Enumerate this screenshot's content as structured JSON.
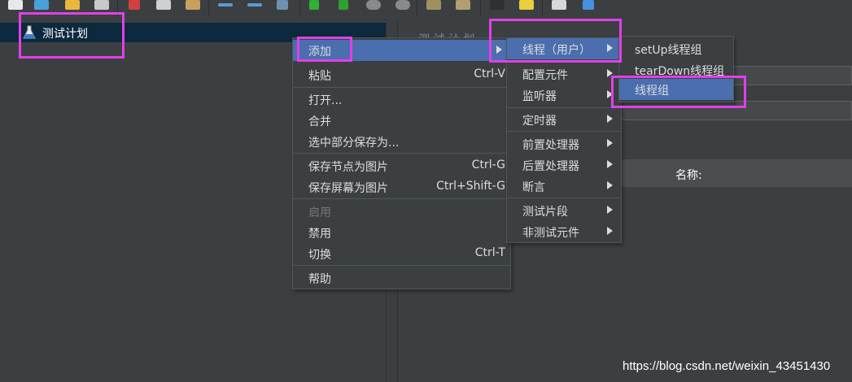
{
  "tree": {
    "root_label": "测试计划"
  },
  "right_panel": {
    "name_label": "名称:",
    "partial_title": "测 试 计 划"
  },
  "menu_main": {
    "items": [
      {
        "label": "添加",
        "shortcut": "",
        "submenu": true,
        "highlighted": true
      },
      {
        "label": "粘贴",
        "shortcut": "Ctrl-V"
      },
      {
        "label": "打开...",
        "shortcut": ""
      },
      {
        "label": "合并",
        "shortcut": ""
      },
      {
        "label": "选中部分保存为...",
        "shortcut": ""
      },
      {
        "label": "保存节点为图片",
        "shortcut": "Ctrl-G"
      },
      {
        "label": "保存屏幕为图片",
        "shortcut": "Ctrl+Shift-G"
      },
      {
        "label": "启用",
        "shortcut": "",
        "disabled": true
      },
      {
        "label": "禁用",
        "shortcut": ""
      },
      {
        "label": "切换",
        "shortcut": "Ctrl-T"
      },
      {
        "label": "帮助",
        "shortcut": ""
      }
    ]
  },
  "menu_add": {
    "items": [
      {
        "label": "线程（用户）",
        "submenu": true,
        "highlighted": true
      },
      {
        "label": "配置元件",
        "submenu": true
      },
      {
        "label": "监听器",
        "submenu": true
      },
      {
        "label": "定时器",
        "submenu": true
      },
      {
        "label": "前置处理器",
        "submenu": true
      },
      {
        "label": "后置处理器",
        "submenu": true
      },
      {
        "label": "断言",
        "submenu": true
      },
      {
        "label": "测试片段",
        "submenu": true
      },
      {
        "label": "非测试元件",
        "submenu": true
      }
    ]
  },
  "menu_threads": {
    "items": [
      {
        "label": "setUp线程组"
      },
      {
        "label": "tearDown线程组"
      },
      {
        "label": "线程组",
        "highlighted": true
      }
    ]
  },
  "watermark": "https://blog.csdn.net/weixin_43451430",
  "colors": {
    "highlight": "#4b6eaf",
    "annotation": "#e040e8",
    "tree_selected": "#0d293e"
  }
}
